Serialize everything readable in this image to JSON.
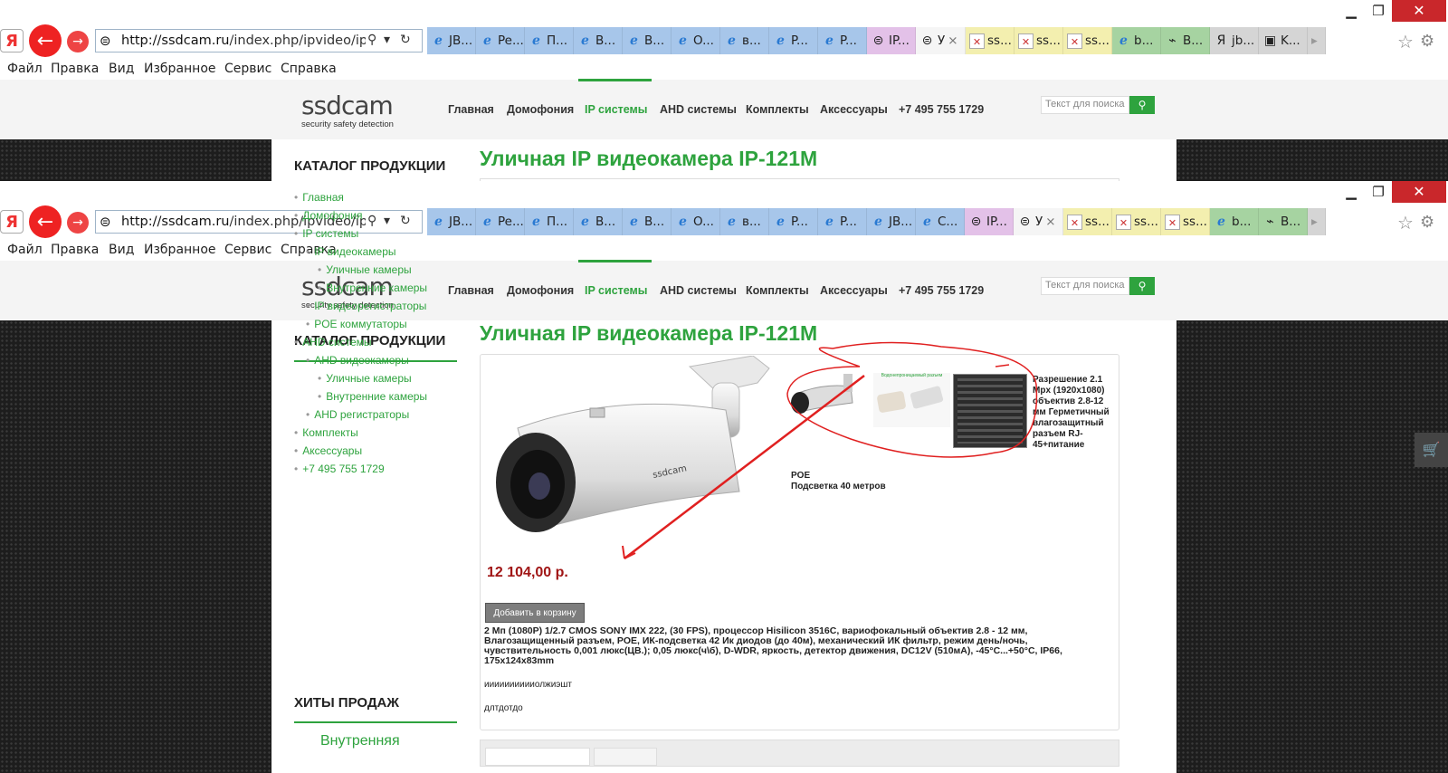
{
  "window": {
    "minimize": "▁",
    "maximize": "❐",
    "close": "✕"
  },
  "browser": {
    "url_host": "http://ssdcam.ru",
    "url_path": "/index.php/ipvideo/ipca",
    "search_glyph": "⚲",
    "dropdown_glyph": "▾",
    "refresh_glyph": "↻",
    "tabs_a": [
      {
        "label": "JB...",
        "icon": "ie-icon",
        "color": "blue"
      },
      {
        "label": "Pe...",
        "icon": "ie-icon",
        "color": "blue"
      },
      {
        "label": "П...",
        "icon": "ie-icon",
        "color": "blue"
      },
      {
        "label": "B...",
        "icon": "ie-icon",
        "color": "blue"
      },
      {
        "label": "B...",
        "icon": "ie-icon",
        "color": "blue"
      },
      {
        "label": "O...",
        "icon": "ie-icon",
        "color": "blue"
      },
      {
        "label": "в...",
        "icon": "ie-icon",
        "color": "blue"
      },
      {
        "label": "P...",
        "icon": "ie-icon",
        "color": "blue"
      },
      {
        "label": "P...",
        "icon": "ie-icon",
        "color": "blue"
      },
      {
        "label": "IP...",
        "icon": "site-icon",
        "color": "pink"
      },
      {
        "label": "У",
        "icon": "site-icon",
        "color": "wht",
        "close": "×"
      },
      {
        "label": "ss...",
        "icon": "joomla-icon",
        "color": "yel"
      },
      {
        "label": "ss...",
        "icon": "joomla-icon",
        "color": "yel"
      },
      {
        "label": "ss...",
        "icon": "joomla-icon",
        "color": "yel"
      },
      {
        "label": "b...",
        "icon": "ie-icon",
        "color": "grn"
      },
      {
        "label": "B...",
        "icon": "camera-icon",
        "color": "grn"
      },
      {
        "label": "jb...",
        "icon": "yandex-icon",
        "color": "gray"
      },
      {
        "label": "K...",
        "icon": "app-icon",
        "color": "gray"
      }
    ],
    "tabs_b": [
      {
        "label": "JB...",
        "icon": "ie-icon",
        "color": "blue"
      },
      {
        "label": "Pe...",
        "icon": "ie-icon",
        "color": "blue"
      },
      {
        "label": "П...",
        "icon": "ie-icon",
        "color": "blue"
      },
      {
        "label": "B...",
        "icon": "ie-icon",
        "color": "blue"
      },
      {
        "label": "B...",
        "icon": "ie-icon",
        "color": "blue"
      },
      {
        "label": "O...",
        "icon": "ie-icon",
        "color": "blue"
      },
      {
        "label": "в...",
        "icon": "ie-icon",
        "color": "blue"
      },
      {
        "label": "P...",
        "icon": "ie-icon",
        "color": "blue"
      },
      {
        "label": "P...",
        "icon": "ie-icon",
        "color": "blue"
      },
      {
        "label": "JB...",
        "icon": "ie-icon",
        "color": "blue"
      },
      {
        "label": "C...",
        "icon": "ie-icon",
        "color": "blue"
      },
      {
        "label": "IP...",
        "icon": "site-icon",
        "color": "pink"
      },
      {
        "label": "У",
        "icon": "site-icon",
        "color": "wht",
        "close": "×"
      },
      {
        "label": "ss...",
        "icon": "joomla-icon",
        "color": "yel"
      },
      {
        "label": "ss...",
        "icon": "joomla-icon",
        "color": "yel"
      },
      {
        "label": "ss...",
        "icon": "joomla-icon",
        "color": "yel"
      },
      {
        "label": "b...",
        "icon": "ie-icon",
        "color": "grn"
      },
      {
        "label": "B...",
        "icon": "camera-icon",
        "color": "grn"
      }
    ]
  },
  "menu": {
    "file": "Файл",
    "edit": "Правка",
    "view": "Вид",
    "favorites": "Избранное",
    "service": "Сервис",
    "help": "Справка"
  },
  "site": {
    "logo": "ssdcam",
    "tagline": "security safety detection",
    "nav": [
      "Главная",
      "Домофония",
      "IP системы",
      "AHD системы",
      "Комплекты",
      "Аксессуары",
      "+7 495 755 1729"
    ],
    "search_placeholder": "Текст для поиска",
    "accent": "#2ea33e"
  },
  "catalog": {
    "title": "КАТАЛОГ ПРОДУКЦИИ",
    "items": [
      {
        "label": "Главная",
        "level": 0
      },
      {
        "label": "Домофония",
        "level": 0
      },
      {
        "label": "IP системы",
        "level": 0
      },
      {
        "label": "IP видеокамеры",
        "level": 1
      },
      {
        "label": "Уличные камеры",
        "level": 2
      },
      {
        "label": "Внутренние камеры",
        "level": 2
      },
      {
        "label": "IP видеорегистраторы",
        "level": 1
      },
      {
        "label": "POE коммутаторы",
        "level": 1
      },
      {
        "label": "AHD системы",
        "level": 0
      },
      {
        "label": "AHD видеокамеры",
        "level": 1
      },
      {
        "label": "Уличные камеры",
        "level": 2
      },
      {
        "label": "Внутренние камеры",
        "level": 2
      },
      {
        "label": "AHD регистраторы",
        "level": 1
      },
      {
        "label": "Комплекты",
        "level": 0
      },
      {
        "label": "Аксессуары",
        "level": 0
      },
      {
        "label": "+7 495 755 1729",
        "level": 0
      }
    ],
    "hits_title": "ХИТЫ ПРОДАЖ",
    "hit_item": "Внутренняя"
  },
  "product": {
    "title": "Уличная IP видеокамера IP-121M",
    "price": "12 104,00 р.",
    "add_to_cart": "Добавить в корзину",
    "feature_right": "Разрешение 2.1 Mpx (1920x1080) объектив 2.8-12 мм Герметичный влагозащитный разъем RJ-45+питание",
    "feature_poe": "POE",
    "feature_ir": "Подсветка 40 метров",
    "description": "2 Мп (1080P) 1/2.7 CMOS SONY IMX 222, (30 FPS), процессор Hisilicon 3516C, вариофокальный объектив 2.8 - 12 мм, Влагозащищенный разъем, POE, ИК-подсветка 42 Ик диодов (до 40м), механический ИК фильтр, режим день/ночь, чувствительность 0,001 люкс(ЦВ.); 0,05 люкс(ч\\б), D-WDR, яркость, детектор движения, DC12V (510мА), -45°C...+50°C, IP66, 175x124x83mm",
    "note1": "ииииииииииолжиэшт",
    "note2": "длтдотдо",
    "thumb_caption": "Водонепроницаемый разъем",
    "camera_brand": "ssdcam"
  },
  "annotation_color": "#e02020"
}
